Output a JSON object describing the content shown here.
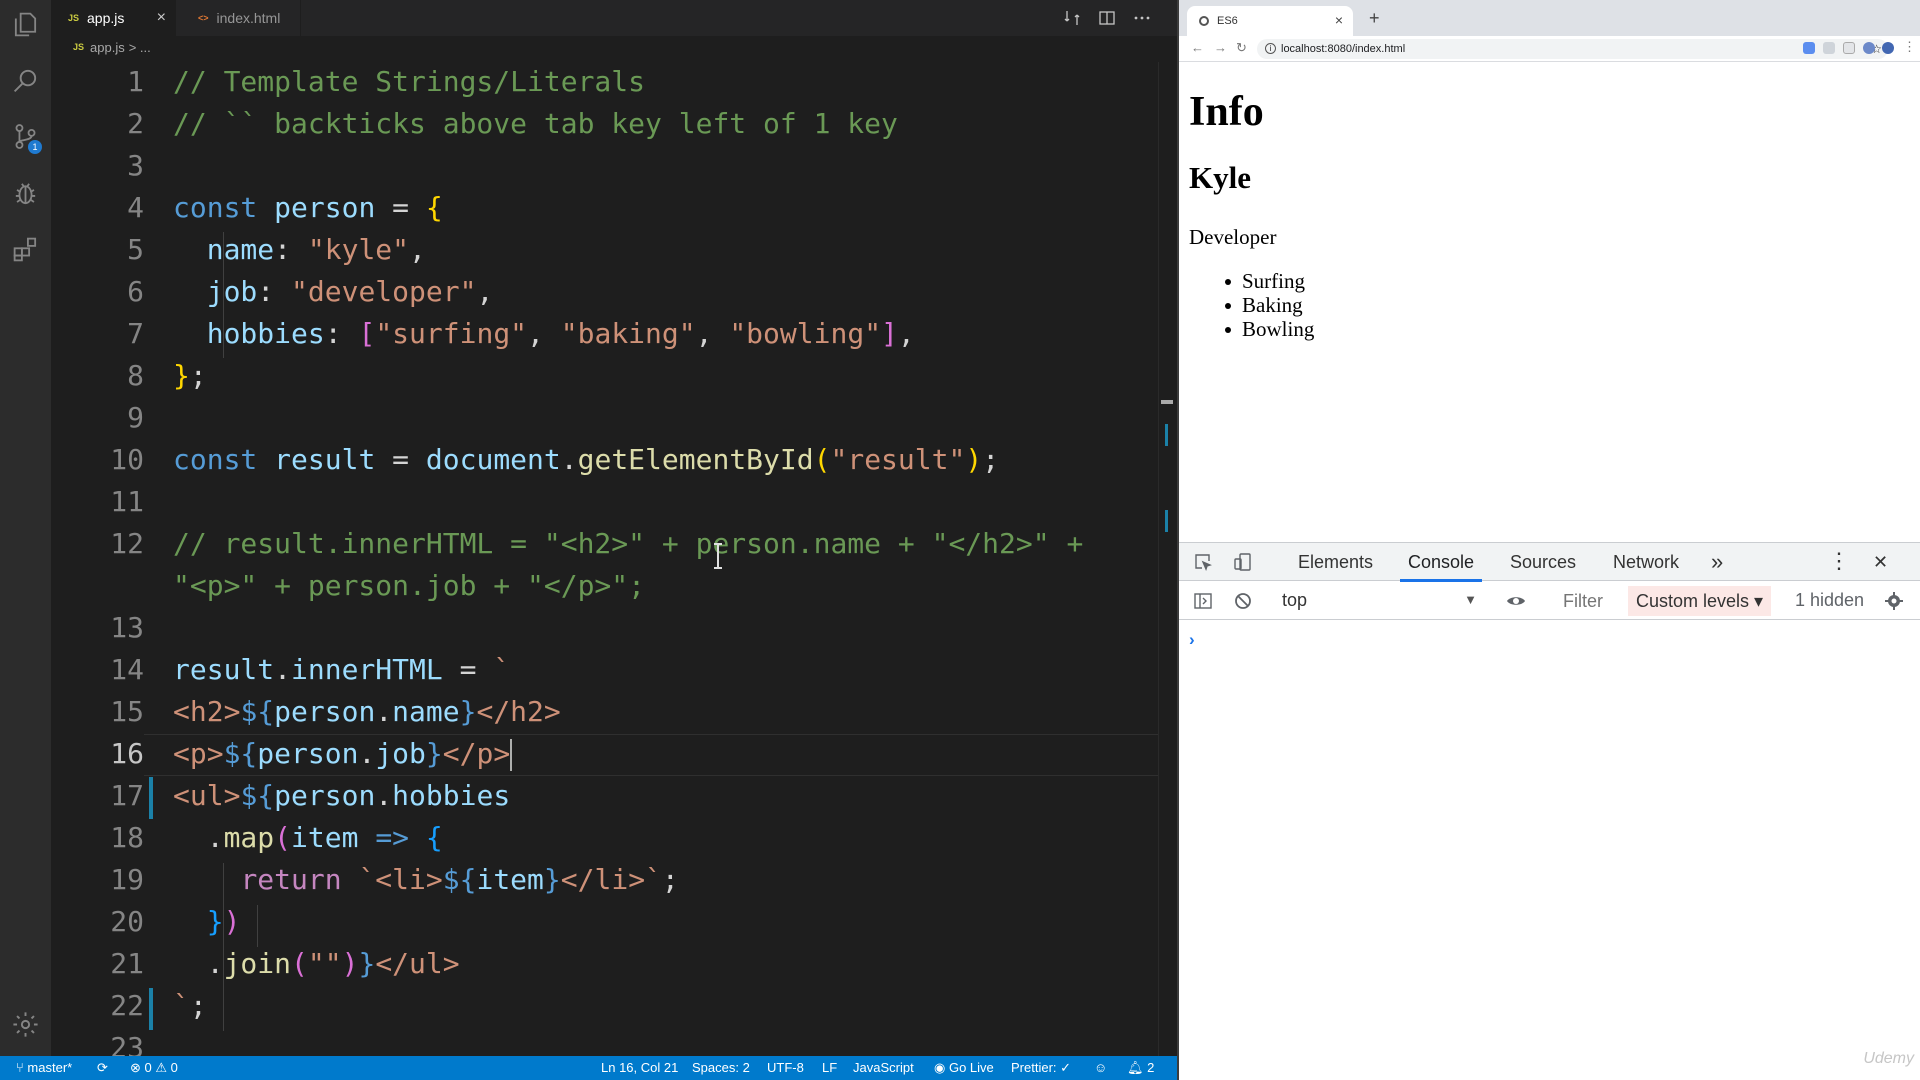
{
  "editor": {
    "tabs": [
      {
        "icon": "JS",
        "label": "app.js",
        "close": "×"
      },
      {
        "icon": "<>",
        "label": "index.html"
      }
    ],
    "breadcrumb": {
      "icon": "JS",
      "file": "app.js",
      "rest": "> ..."
    },
    "line_numbers": [
      "1",
      "2",
      "3",
      "4",
      "5",
      "6",
      "7",
      "8",
      "9",
      "10",
      "11",
      "12",
      "",
      "13",
      "14",
      "15",
      "16",
      "17",
      "18",
      "19",
      "20",
      "21",
      "22",
      "23"
    ],
    "activity_badge": "1"
  },
  "statusbar": {
    "branch": "master*",
    "errors": "0",
    "warnings": "0",
    "position": "Ln 16, Col 21",
    "spaces": "Spaces: 2",
    "encoding": "UTF-8",
    "eol": "LF",
    "language": "JavaScript",
    "golive": "Go Live",
    "prettier": "Prettier: ✓",
    "notifications": "2"
  },
  "browser": {
    "tab_title": "ES6",
    "tab_close": "×",
    "new_tab": "+",
    "url": "localhost:8080/index.html",
    "page": {
      "h1": "Info",
      "h2": "Kyle",
      "job": "Developer",
      "hobbies": [
        "Surfing",
        "Baking",
        "Bowling"
      ]
    }
  },
  "devtools": {
    "tabs": [
      "Elements",
      "Console",
      "Sources",
      "Network"
    ],
    "more": "»",
    "close": "✕",
    "context": "top",
    "filter_placeholder": "Filter",
    "levels": "Custom levels ▾",
    "hidden": "1 hidden",
    "prompt": "›"
  },
  "watermark": "Udemy"
}
